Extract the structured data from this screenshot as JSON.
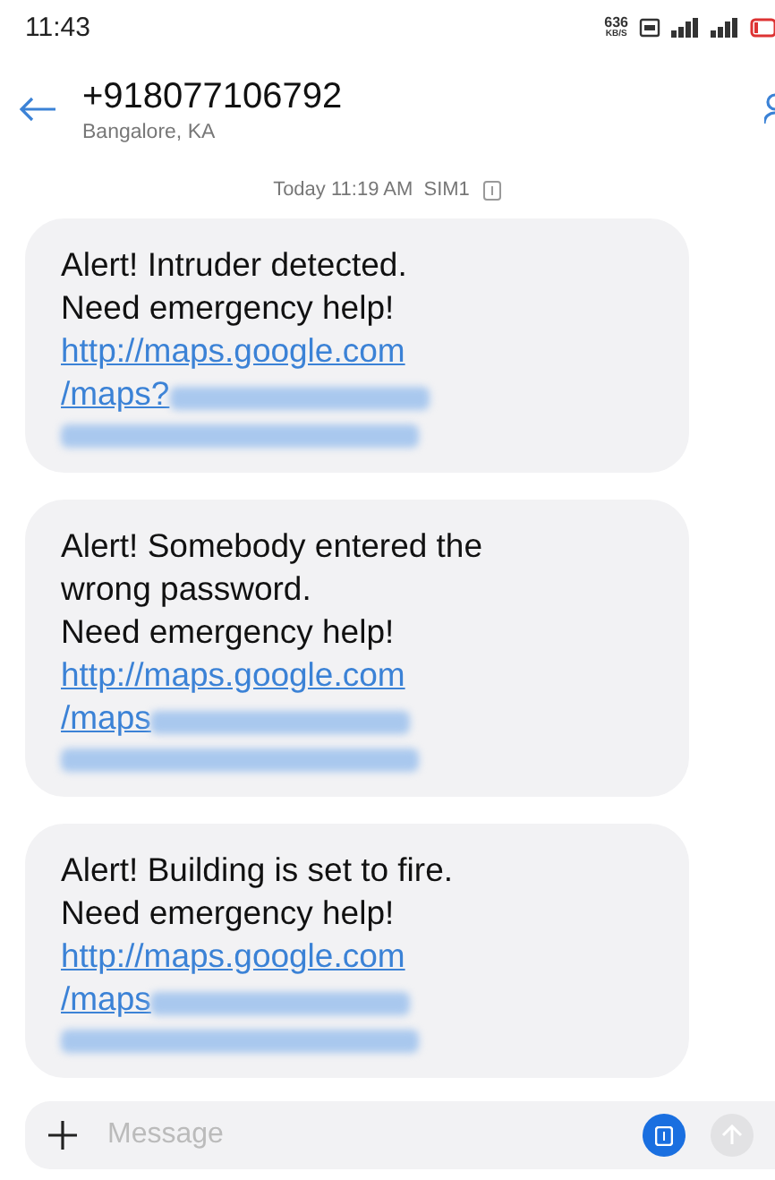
{
  "status_bar": {
    "time": "11:43",
    "speed": "636",
    "speed_unit": "KB/S"
  },
  "header": {
    "title": "+918077106792",
    "subtitle": "Bangalore, KA"
  },
  "timestamp": {
    "text": "Today 11:19 AM  SIM1"
  },
  "messages": [
    {
      "lines": [
        "Alert! Intruder detected.",
        "Need emergency help!"
      ],
      "link_lines": [
        "http://maps.google.com",
        "/maps?"
      ]
    },
    {
      "lines": [
        "Alert! Somebody entered the",
        "wrong password.",
        "Need emergency help!"
      ],
      "link_lines": [
        "http://maps.google.com",
        "/maps"
      ]
    },
    {
      "lines": [
        "Alert! Building is set to fire.",
        "Need emergency help!"
      ],
      "link_lines": [
        "http://maps.google.com",
        "/maps"
      ]
    }
  ],
  "composer": {
    "placeholder": "Message"
  }
}
